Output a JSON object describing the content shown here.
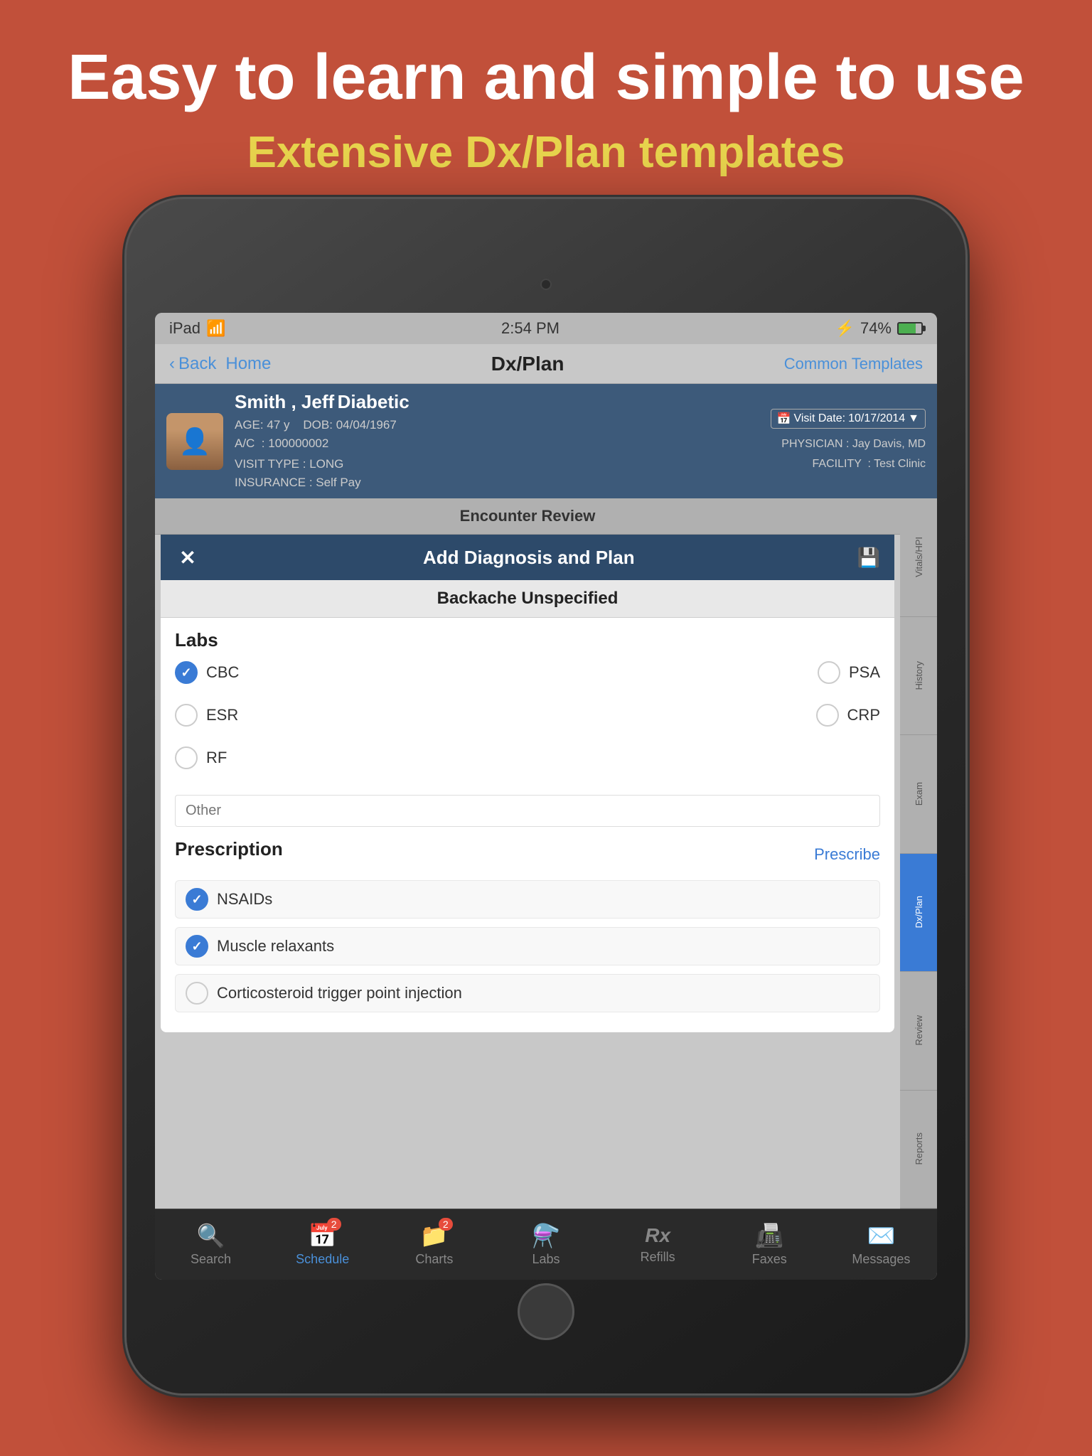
{
  "promo": {
    "title": "Easy to learn and simple to use",
    "subtitle": "Extensive Dx/Plan templates"
  },
  "status_bar": {
    "device": "iPad",
    "wifi_icon": "📶",
    "time": "2:54 PM",
    "bluetooth": "⚡",
    "battery_percent": "74%"
  },
  "nav": {
    "back_label": "Back",
    "home_label": "Home",
    "title": "Dx/Plan",
    "right_action": "Common Templates"
  },
  "patient": {
    "name": "Smith , Jeff",
    "diabetic_label": "Diabetic",
    "age_label": "AGE",
    "age": "47 y",
    "dob_label": "DOB",
    "dob": "04/04/1967",
    "ac_label": "A/C",
    "ac": "100000002",
    "visit_type_label": "VISIT TYPE",
    "visit_type": "LONG",
    "insurance_label": "INSURANCE",
    "insurance": "Self Pay",
    "visit_date_label": "Visit Date:",
    "visit_date": "10/17/2014",
    "physician_label": "PHYSICIAN",
    "physician": "Jay Davis, MD",
    "facility_label": "FACILITY",
    "facility": "Test Clinic"
  },
  "encounter_review": {
    "title": "Encounter Review"
  },
  "dialog": {
    "close_icon": "✕",
    "title": "Add  Diagnosis and Plan",
    "save_icon": "💾",
    "subtitle": "Backache Unspecified"
  },
  "labs": {
    "section_title": "Labs",
    "items": [
      {
        "id": "cbc",
        "label": "CBC",
        "checked": true,
        "col": 0
      },
      {
        "id": "psa",
        "label": "PSA",
        "checked": false,
        "col": 1
      },
      {
        "id": "esr",
        "label": "ESR",
        "checked": false,
        "col": 0
      },
      {
        "id": "crp",
        "label": "CRP",
        "checked": false,
        "col": 1
      },
      {
        "id": "rf",
        "label": "RF",
        "checked": false,
        "col": 0
      }
    ],
    "other_placeholder": "Other"
  },
  "prescription": {
    "section_title": "Prescription",
    "prescribe_label": "Prescribe",
    "items": [
      {
        "id": "nsaids",
        "label": "NSAIDs",
        "checked": true
      },
      {
        "id": "muscle_relaxants",
        "label": "Muscle relaxants",
        "checked": true
      },
      {
        "id": "corticosteroid",
        "label": "Corticosteroid trigger point injection",
        "checked": false
      }
    ]
  },
  "sidebar_tabs": [
    {
      "id": "vitals",
      "label": "Vitals/HPI",
      "active": false
    },
    {
      "id": "history",
      "label": "History",
      "active": false
    },
    {
      "id": "exam",
      "label": "Exam",
      "active": false
    },
    {
      "id": "dxplan",
      "label": "Dx/Plan",
      "active": true
    },
    {
      "id": "review",
      "label": "Review",
      "active": false
    },
    {
      "id": "reports",
      "label": "Reports",
      "active": false
    }
  ],
  "bottom_nav": [
    {
      "id": "search",
      "icon": "🔍",
      "label": "Search",
      "active": false,
      "badge": null
    },
    {
      "id": "schedule",
      "icon": "📅",
      "label": "Schedule",
      "active": true,
      "badge": "2"
    },
    {
      "id": "charts",
      "icon": "📁",
      "label": "Charts",
      "active": false,
      "badge": "2"
    },
    {
      "id": "labs",
      "icon": "🔬",
      "label": "Labs",
      "active": false,
      "badge": null
    },
    {
      "id": "refills",
      "icon": "Rx",
      "label": "Refills",
      "active": false,
      "badge": null
    },
    {
      "id": "faxes",
      "icon": "📠",
      "label": "Faxes",
      "active": false,
      "badge": null
    },
    {
      "id": "messages",
      "icon": "✉️",
      "label": "Messages",
      "active": false,
      "badge": null
    }
  ]
}
